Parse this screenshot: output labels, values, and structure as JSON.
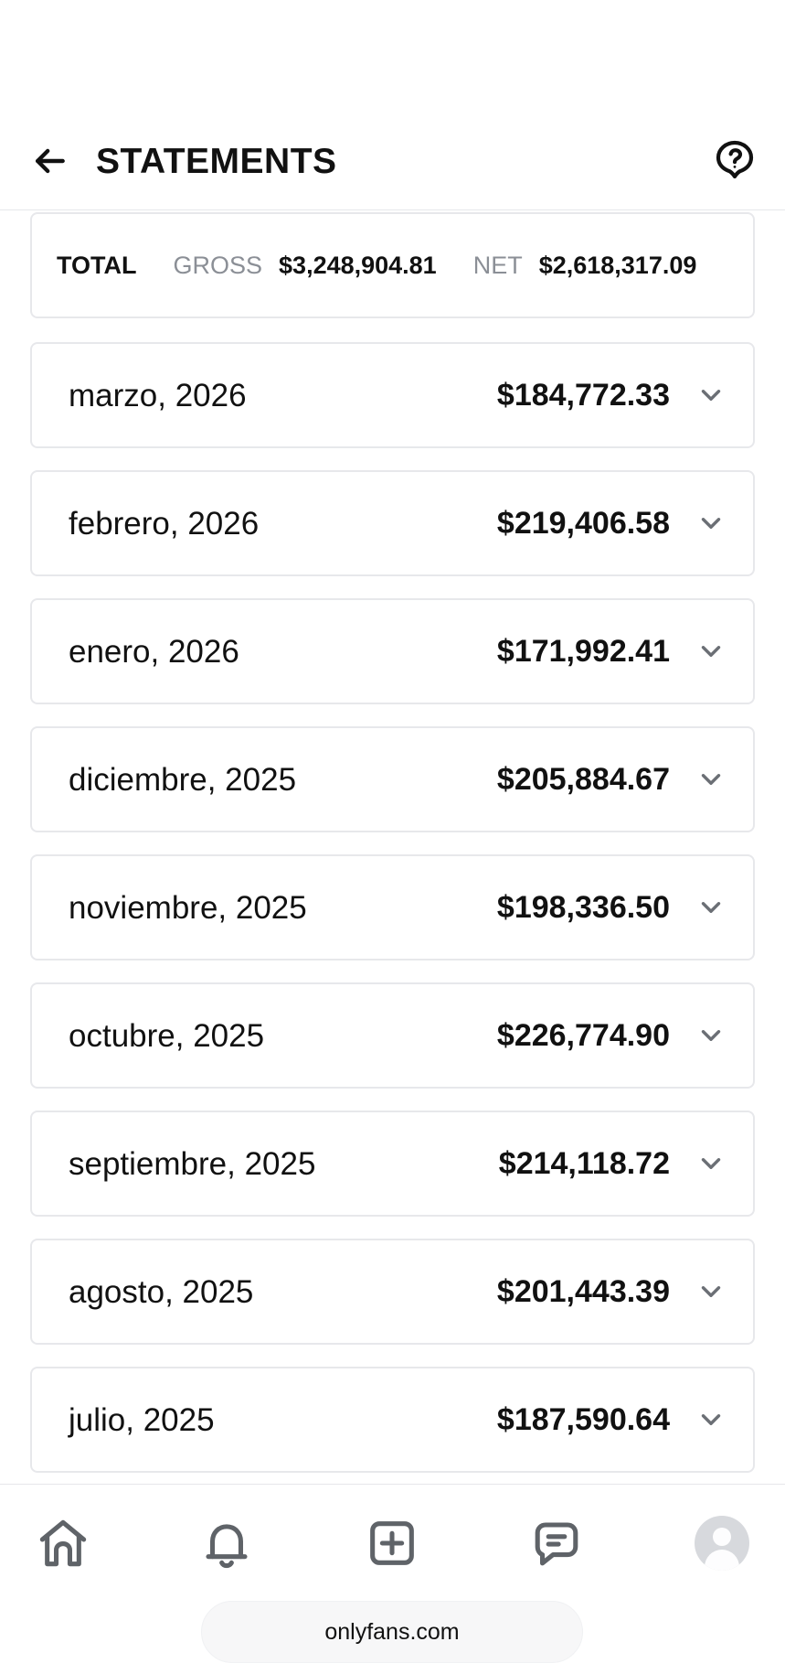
{
  "header": {
    "title": "STATEMENTS",
    "back_icon": "arrow-left-icon",
    "help_icon": "help-icon"
  },
  "totals": {
    "label": "TOTAL",
    "gross_label": "GROSS",
    "gross_value": "$3,248,904.81",
    "net_label": "NET",
    "net_value": "$2,618,317.09"
  },
  "statements": [
    {
      "month": "marzo, 2026",
      "amount": "$184,772.33"
    },
    {
      "month": "febrero, 2026",
      "amount": "$219,406.58"
    },
    {
      "month": "enero, 2026",
      "amount": "$171,992.41"
    },
    {
      "month": "diciembre, 2025",
      "amount": "$205,884.67"
    },
    {
      "month": "noviembre, 2025",
      "amount": "$198,336.50"
    },
    {
      "month": "octubre, 2025",
      "amount": "$226,774.90"
    },
    {
      "month": "septiembre, 2025",
      "amount": "$214,118.72"
    },
    {
      "month": "agosto, 2025",
      "amount": "$201,443.39"
    },
    {
      "month": "julio, 2025",
      "amount": "$187,590.64"
    }
  ],
  "bottom_nav": {
    "items": [
      {
        "icon": "home-icon"
      },
      {
        "icon": "bell-icon"
      },
      {
        "icon": "plus-square-icon"
      },
      {
        "icon": "chat-icon"
      },
      {
        "icon": "avatar-icon"
      }
    ]
  },
  "browser": {
    "url": "onlyfans.com"
  },
  "colors": {
    "text": "#111111",
    "muted": "#8b8f96",
    "border": "#e7e8eb",
    "icon": "#5f6368"
  }
}
